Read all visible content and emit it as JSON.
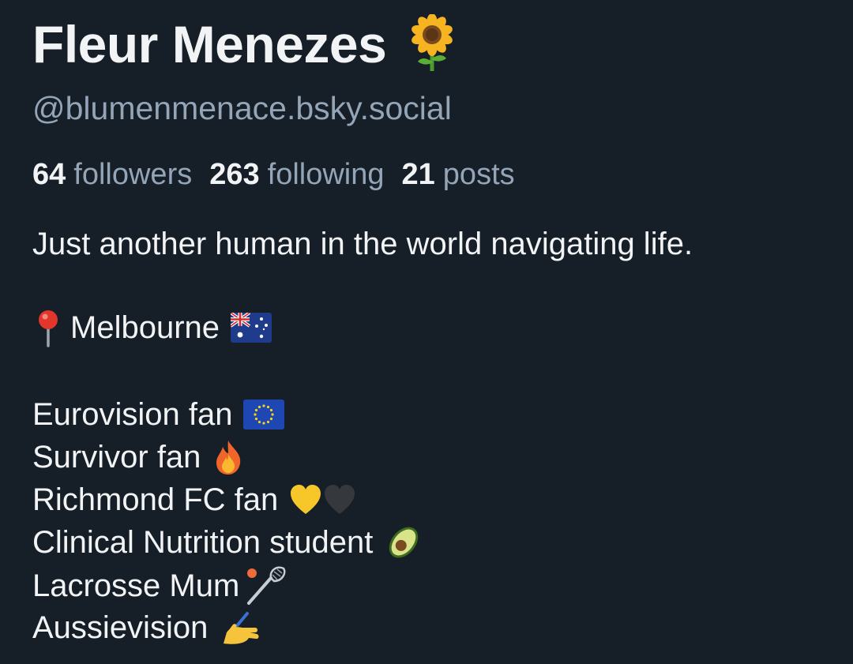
{
  "profile": {
    "display_name": "Fleur Menezes",
    "name_emoji": "sunflower-icon",
    "handle": "@blumenmenace.bsky.social",
    "stats": {
      "followers_count": "64",
      "followers_label": "followers",
      "following_count": "263",
      "following_label": "following",
      "posts_count": "21",
      "posts_label": "posts"
    },
    "bio": {
      "line1": "Just another human in the world navigating life.",
      "location": "Melbourne",
      "location_icon": "round-pushpin-icon",
      "location_flag": "australia-flag-icon",
      "interests": [
        {
          "text": "Eurovision fan",
          "icon": "eu-flag-icon"
        },
        {
          "text": "Survivor fan",
          "icon": "fire-icon"
        },
        {
          "text": "Richmond FC fan",
          "icon": "yellow-heart-black-heart-icon"
        },
        {
          "text": "Clinical Nutrition student",
          "icon": "avocado-icon"
        },
        {
          "text": "Lacrosse Mum",
          "icon": "lacrosse-icon"
        },
        {
          "text": "Aussievision",
          "icon": "writing-hand-icon"
        }
      ]
    }
  },
  "colors": {
    "background": "#161e27",
    "primary_text": "#f1f3f5",
    "secondary_text": "#93a5b7"
  }
}
